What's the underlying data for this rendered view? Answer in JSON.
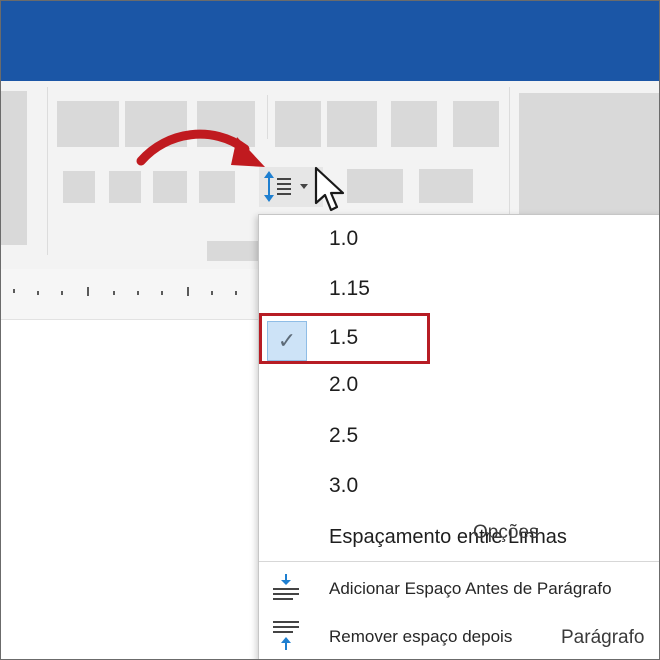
{
  "menu": {
    "items": [
      {
        "label": "1.0"
      },
      {
        "label": "1.15"
      },
      {
        "label": "1.5",
        "selected": true
      },
      {
        "label": "2.0"
      },
      {
        "label": "2.5"
      },
      {
        "label": "3.0"
      }
    ],
    "options_label": "Espaçamento entre Linhas",
    "options_overlap_label": "Opções",
    "add_space_before": "Adicionar Espaço Antes de Parágrafo",
    "remove_space_after": "Remover espaço depois",
    "paragraph_overlap": "Parágrafo",
    "check_glyph": "✓"
  },
  "icons": {
    "line_spacing": "line-spacing-icon",
    "dropdown": "caret-down-icon",
    "cursor": "mouse-pointer-icon",
    "arrow": "red-curved-arrow"
  },
  "colors": {
    "titlebar": "#1b56a6",
    "highlight_border": "#b71c24",
    "selected_bg": "#cde3f7",
    "icon_blue": "#1e7fd0",
    "arrow_red": "#c01a1f"
  }
}
